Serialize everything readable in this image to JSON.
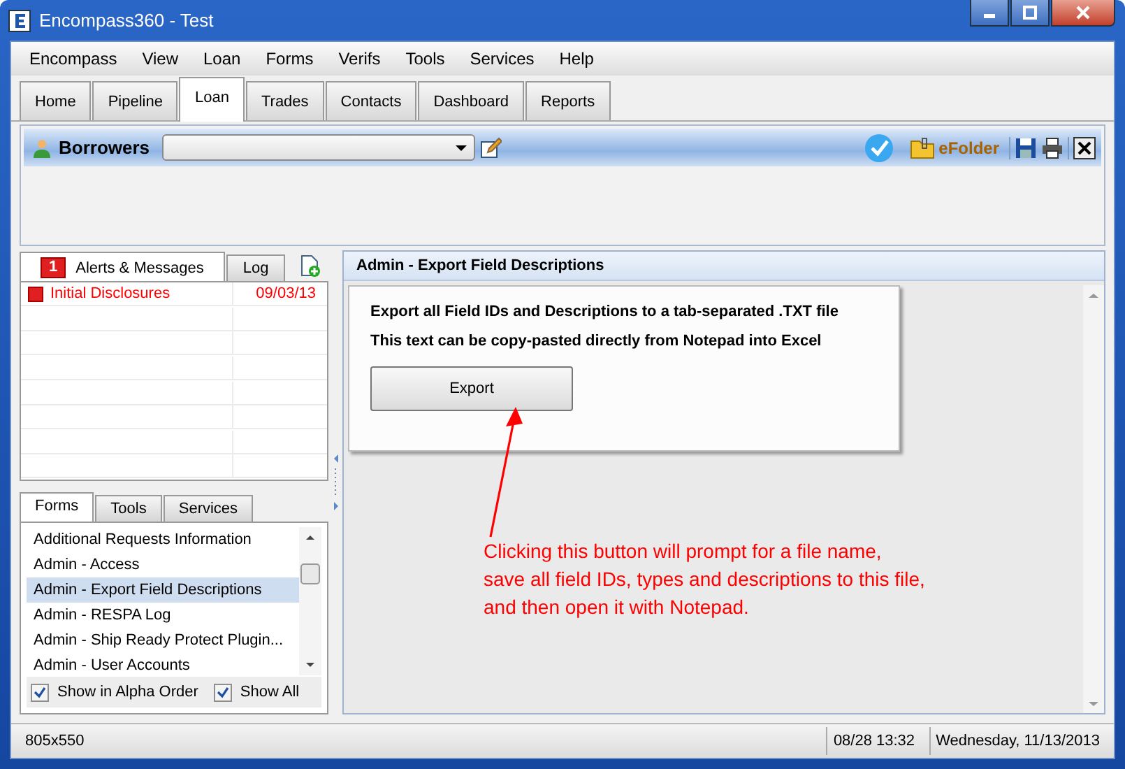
{
  "window": {
    "title": "Encompass360 - Test"
  },
  "menu": [
    "Encompass",
    "View",
    "Loan",
    "Forms",
    "Verifs",
    "Tools",
    "Services",
    "Help"
  ],
  "tabs": [
    {
      "label": "Home",
      "selected": false
    },
    {
      "label": "Pipeline",
      "selected": false
    },
    {
      "label": "Loan",
      "selected": true
    },
    {
      "label": "Trades",
      "selected": false
    },
    {
      "label": "Contacts",
      "selected": false
    },
    {
      "label": "Dashboard",
      "selected": false
    },
    {
      "label": "Reports",
      "selected": false
    }
  ],
  "toolbar": {
    "title": "Borrowers",
    "efolder": "eFolder"
  },
  "alerts": {
    "tabs": [
      {
        "label": "Alerts & Messages",
        "badge": "1",
        "selected": true
      },
      {
        "label": "Log",
        "selected": false
      }
    ],
    "rows": [
      {
        "name": "Initial Disclosures",
        "date": "09/03/13"
      }
    ]
  },
  "forms": {
    "tabs": [
      {
        "label": "Forms",
        "selected": true
      },
      {
        "label": "Tools",
        "selected": false
      },
      {
        "label": "Services",
        "selected": false
      }
    ],
    "items": [
      {
        "label": "Additional Requests Information",
        "selected": false
      },
      {
        "label": "Admin - Access",
        "selected": false
      },
      {
        "label": "Admin - Export Field Descriptions",
        "selected": true
      },
      {
        "label": "Admin - RESPA Log",
        "selected": false
      },
      {
        "label": "Admin -  Ship Ready Protect Plugin...",
        "selected": false
      },
      {
        "label": "Admin - User Accounts",
        "selected": false
      }
    ],
    "options": [
      {
        "label": "Show in Alpha Order",
        "checked": true
      },
      {
        "label": "Show All",
        "checked": true
      }
    ]
  },
  "content": {
    "title": "Admin - Export Field Descriptions",
    "lines": [
      "Export all Field IDs and Descriptions to a tab-separated .TXT file",
      "This text can be copy-pasted directly from Notepad into Excel"
    ],
    "button": "Export"
  },
  "annotation": {
    "lines": [
      "Clicking this button will prompt for a file name,",
      "save all field IDs, types and descriptions to this file,",
      "and then open it with Notepad."
    ]
  },
  "status_bar": {
    "size": "805x550",
    "time": "08/28 13:32",
    "date": "Wednesday, 11/13/2013"
  }
}
